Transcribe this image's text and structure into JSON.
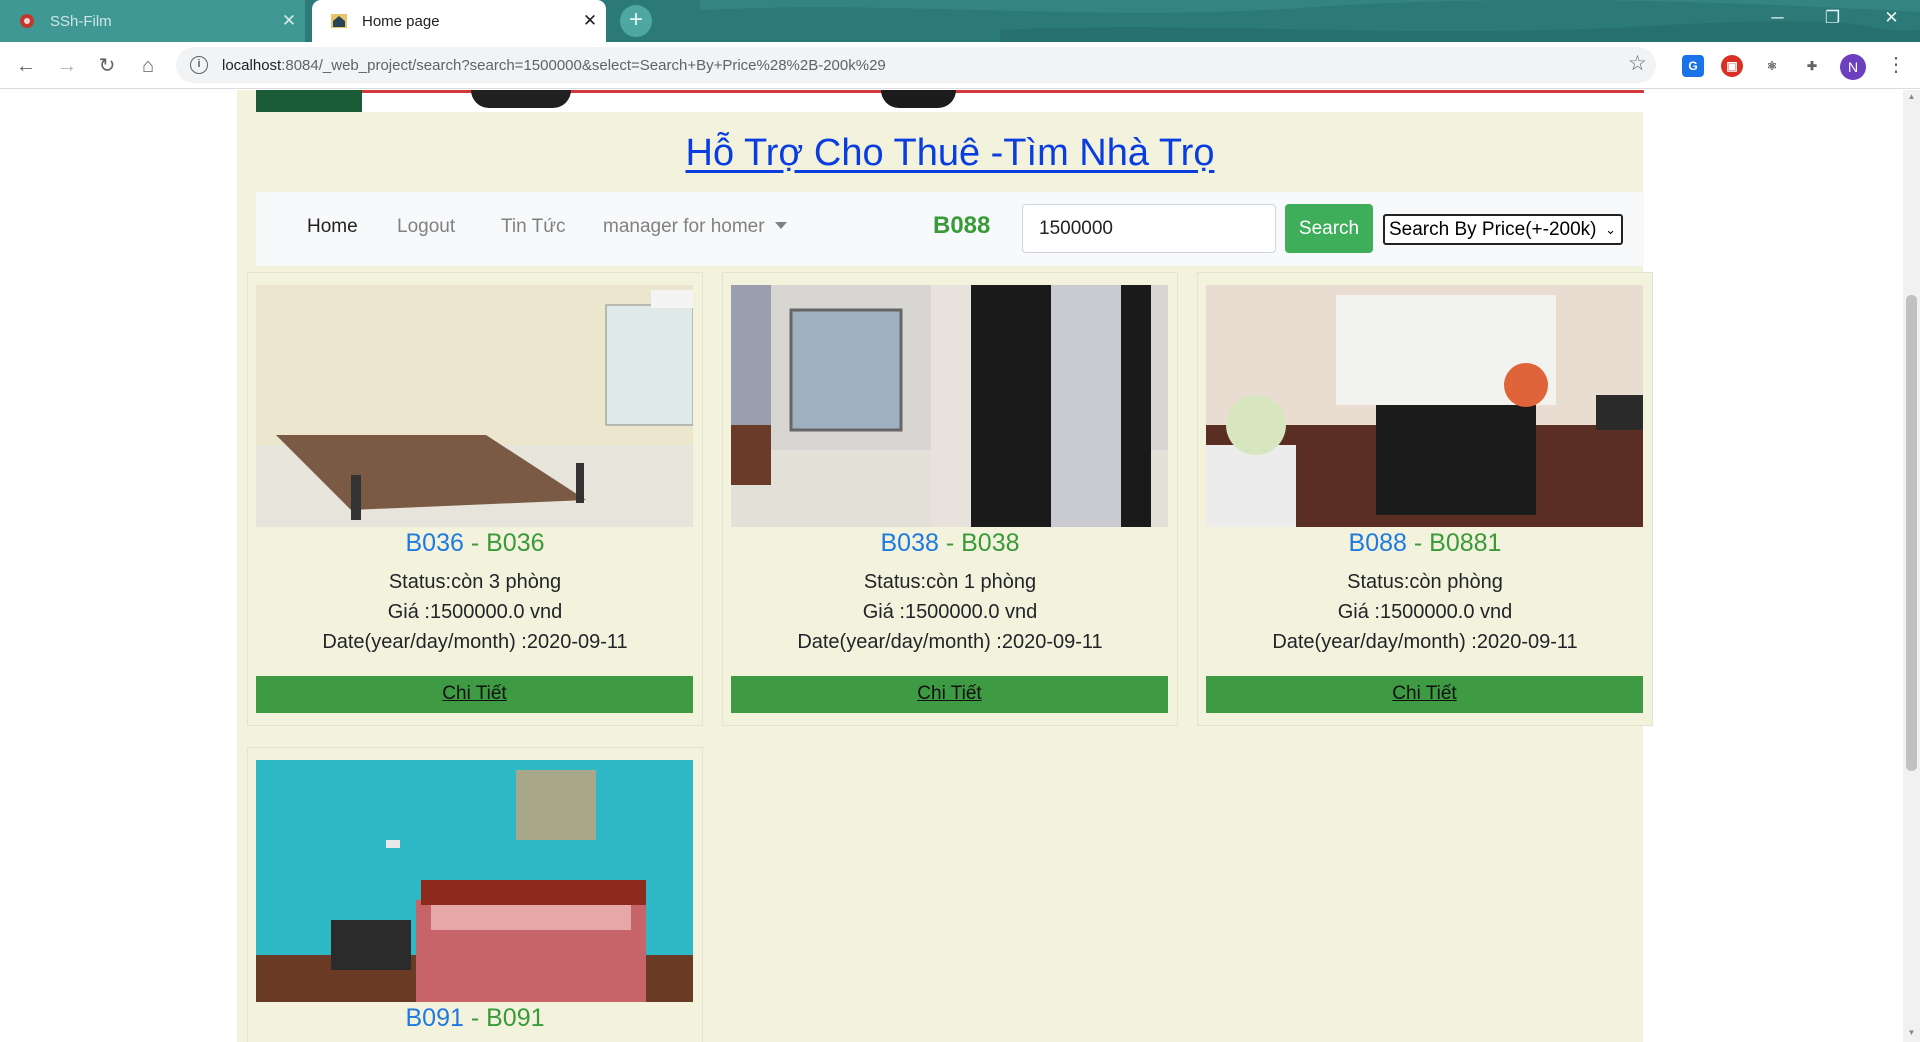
{
  "browser": {
    "tabs": [
      {
        "title": "SSh-Film",
        "active": false
      },
      {
        "title": "Home page",
        "active": true
      }
    ],
    "url_host": "localhost",
    "url_path": ":8084/_web_project/search?search=1500000&select=Search+By+Price%28%2B-200k%29",
    "profile_initial": "N"
  },
  "site": {
    "title": "Hỗ Trợ Cho Thuê -Tìm Nhà Trọ"
  },
  "nav": {
    "home": "Home",
    "logout": "Logout",
    "news": "Tin Tức",
    "manager": "manager for homer",
    "user_code": "B088",
    "search_value": "1500000",
    "search_button": "Search",
    "select_value": "Search By Price(+-200k)"
  },
  "listings": [
    {
      "code": "B036",
      "sub": "B036",
      "status": "Status:còn 3 phòng",
      "price": "Giá :1500000.0 vnd",
      "date": "Date(year/day/month) :2020-09-11",
      "button": "Chi Tiết"
    },
    {
      "code": "B038",
      "sub": "B038",
      "status": "Status:còn 1 phòng",
      "price": "Giá :1500000.0 vnd",
      "date": "Date(year/day/month) :2020-09-11",
      "button": "Chi Tiết"
    },
    {
      "code": "B088",
      "sub": "B0881",
      "status": "Status:còn phòng",
      "price": "Giá :1500000.0 vnd",
      "date": "Date(year/day/month) :2020-09-11",
      "button": "Chi Tiết"
    },
    {
      "code": "B091",
      "sub": "B091"
    }
  ],
  "name_separator": " - "
}
